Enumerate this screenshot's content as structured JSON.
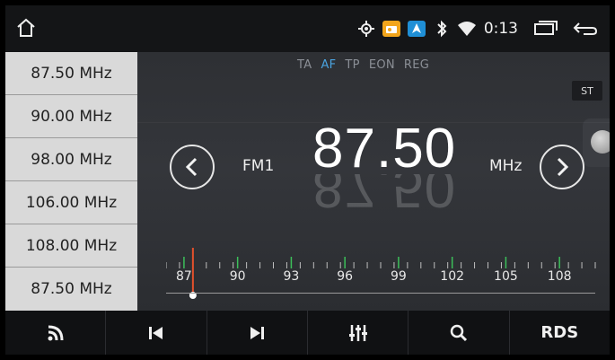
{
  "status_bar": {
    "time": "0:13",
    "icons": [
      "home-icon",
      "location-icon",
      "radio-app-icon",
      "nav-app-icon",
      "bluetooth-icon",
      "wifi-icon",
      "recent-apps-icon",
      "back-icon"
    ]
  },
  "presets": [
    {
      "label": "87.50 MHz"
    },
    {
      "label": "90.00 MHz"
    },
    {
      "label": "98.00 MHz"
    },
    {
      "label": "106.00 MHz"
    },
    {
      "label": "108.00 MHz"
    },
    {
      "label": "87.50 MHz"
    }
  ],
  "flags": [
    {
      "label": "TA",
      "active": false
    },
    {
      "label": "AF",
      "active": true
    },
    {
      "label": "TP",
      "active": false
    },
    {
      "label": "EON",
      "active": false
    },
    {
      "label": "REG",
      "active": false
    }
  ],
  "stereo_badge": "ST",
  "tuner": {
    "band": "FM1",
    "frequency": "87.50",
    "unit": "MHz",
    "scale_labels": [
      "87",
      "90",
      "93",
      "96",
      "99",
      "102",
      "105",
      "108"
    ],
    "scale_min": 86,
    "scale_max": 110,
    "current": 87.5
  },
  "bottom_bar": {
    "rds_label": "RDS",
    "icons": [
      "scan-icon",
      "previous-icon",
      "next-icon",
      "equalizer-icon",
      "search-icon"
    ]
  },
  "colors": {
    "accent": "#4aa3df",
    "needle": "#e2502c",
    "green_tick": "#3cbf5a"
  }
}
